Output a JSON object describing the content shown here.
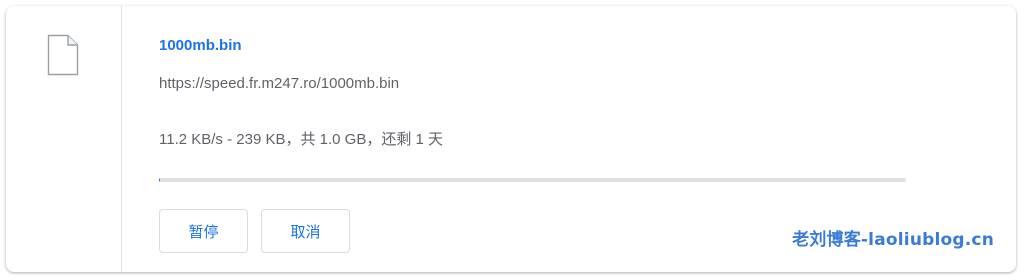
{
  "download": {
    "filename": "1000mb.bin",
    "url": "https://speed.fr.m247.ro/1000mb.bin",
    "status": "11.2 KB/s - 239 KB，共 1.0 GB，还剩 1 天",
    "progress_fraction": 0.000228,
    "pause_label": "暂停",
    "cancel_label": "取消"
  },
  "icons": {
    "file": "file-icon"
  },
  "colors": {
    "accent": "#1a73e8",
    "text_secondary": "#5f6368",
    "track": "#e0e0e0",
    "watermark": "#3a7bd5"
  },
  "watermark": {
    "text": "老刘博客-laoliublog.cn"
  }
}
